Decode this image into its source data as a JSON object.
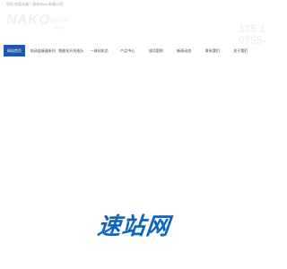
{
  "topbar": {
    "welcome_text": "您好,欢迎光临！深圳市xxx有限公司"
  },
  "header": {
    "logo_text": "NAKO",
    "logo_sub": "",
    "logo_cn_line1": "纳科电子",
    "logo_cn_line2": "股份",
    "phone_line1": "135 1",
    "phone_line2": "0755-"
  },
  "nav": {
    "items": [
      {
        "label": "网站首页",
        "active": true
      },
      {
        "label": "电动连接器系列",
        "active": false
      },
      {
        "label": "智能化开关插头",
        "active": false
      },
      {
        "label": "一体化机芯",
        "active": false
      },
      {
        "label": "产品中心",
        "active": false
      },
      {
        "label": "成功案例",
        "active": false
      },
      {
        "label": "新闻动态",
        "active": false
      },
      {
        "label": "联系我们",
        "active": false
      },
      {
        "label": "关于我们",
        "active": false
      }
    ]
  },
  "watermark": {
    "text": "速站网"
  },
  "colors": {
    "nav_active_bg": "#1b57b3",
    "watermark": "#0c65c1",
    "background": "#ffffff"
  }
}
